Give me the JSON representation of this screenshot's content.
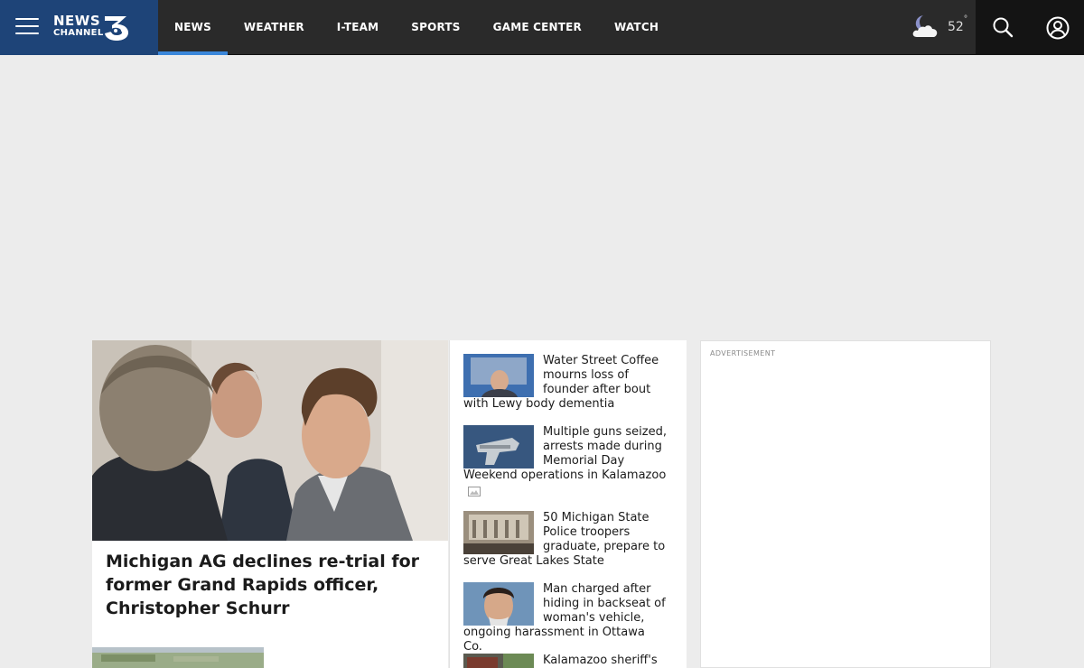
{
  "brand": {
    "logo_line1": "NEWS",
    "logo_line2": "CHANNEL",
    "logo_number": "3",
    "color": "#1e4478"
  },
  "nav": {
    "items": [
      {
        "label": "NEWS",
        "active": true
      },
      {
        "label": "WEATHER",
        "active": false
      },
      {
        "label": "I-TEAM",
        "active": false
      },
      {
        "label": "SPORTS",
        "active": false
      },
      {
        "label": "GAME CENTER",
        "active": false
      },
      {
        "label": "WATCH",
        "active": false
      }
    ],
    "active_color": "#3a86d9"
  },
  "weather": {
    "icon": "partly-cloudy-night-icon",
    "temperature": "52",
    "degree_symbol": "°"
  },
  "header_icons": {
    "menu": "hamburger-menu-icon",
    "search": "search-icon",
    "account": "account-icon"
  },
  "lead_story": {
    "title": "Michigan AG declines re-trial for former Grand Rapids officer, Christopher Schurr"
  },
  "stories": [
    {
      "title": "Water Street Coffee mourns loss of founder after bout with Lewy body dementia",
      "has_gallery": false
    },
    {
      "title": "Multiple guns seized, arrests made during Memorial Day Weekend operations in Kalamazoo",
      "has_gallery": true
    },
    {
      "title": "50 Michigan State Police troopers graduate, prepare to serve Great Lakes State",
      "has_gallery": false
    },
    {
      "title": "Man charged after hiding in backseat of woman's vehicle, ongoing harassment in Ottawa Co.",
      "has_gallery": false
    },
    {
      "title": "Kalamazoo sheriff's",
      "has_gallery": false
    }
  ],
  "advertisement": {
    "label": "ADVERTISEMENT"
  }
}
